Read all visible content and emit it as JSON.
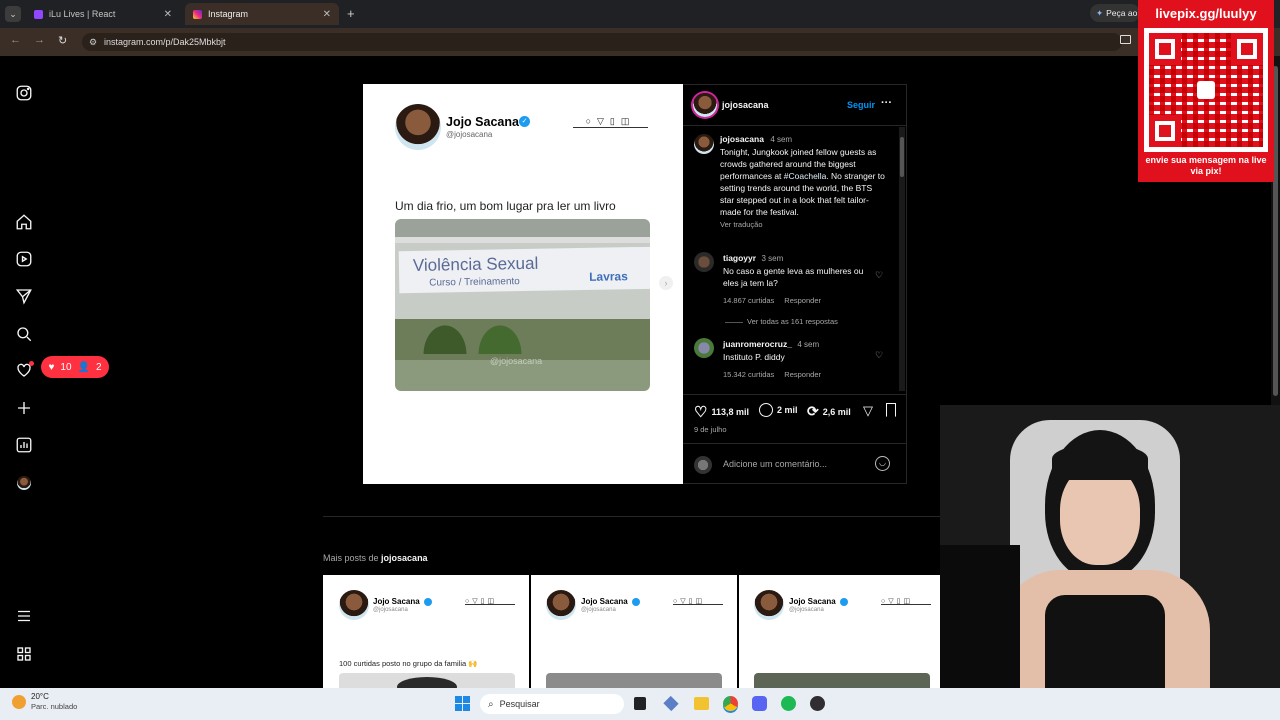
{
  "browser": {
    "tabs": [
      {
        "title": "iLu Lives | React"
      },
      {
        "title": "Instagram"
      }
    ],
    "url": "instagram.com/p/Dak25Mbkbjt",
    "ask_button": "Peça ao"
  },
  "sidebar": {
    "notif_likes": "10",
    "notif_follows": "2"
  },
  "post": {
    "image": {
      "author_name": "Jojo Sacana",
      "author_handle": "@jojosacana",
      "caption": "Um dia frio, um bom lugar pra ler um livro",
      "banner_text": "Violência Sexual",
      "banner_sub": "Curso / Treinamento",
      "banner_logo": "Lavras",
      "watermark": "@jojosacana"
    },
    "header": {
      "username": "jojosacana",
      "follow": "Seguir",
      "more": "···"
    },
    "caption": {
      "username": "jojosacana",
      "time": "4 sem",
      "text_before": "Tonight, Jungkook joined fellow guests as crowds gathered around the biggest performances at ",
      "hashtag": "#Coachella",
      "text_after": ". No stranger to setting trends around the world, the BTS star stepped out in a look that felt tailor-made for the festival.",
      "translate": "Ver tradução"
    },
    "comments": [
      {
        "username": "tiagoyyr",
        "time": "3 sem",
        "text": "No caso a gente leva as mulheres ou eles ja tem la?",
        "likes": "14.867 curtidas",
        "reply": "Responder",
        "view_replies": "Ver todas as 161 respostas"
      },
      {
        "username": "juanromerocruz_",
        "time": "4 sem",
        "text": "Instituto P. diddy",
        "likes": "15.342 curtidas",
        "reply": "Responder"
      }
    ],
    "actions": {
      "likes": "113,8 mil",
      "comments": "2 mil",
      "reposts": "2,6 mil"
    },
    "date": "9 de julho",
    "add_comment_placeholder": "Adicione um comentário..."
  },
  "more_posts": {
    "label": "Mais posts de",
    "username": "jojosacana",
    "cards": [
      {
        "name": "Jojo Sacana",
        "handle": "@jojosacana",
        "caption": "100 curtidas posto no grupo da familia 🙌"
      },
      {
        "name": "Jojo Sacana",
        "handle": "@jojosacana",
        "caption": ""
      },
      {
        "name": "Jojo Sacana",
        "handle": "@jojosacana",
        "caption": ""
      }
    ]
  },
  "overlay": {
    "livepix_url": "livepix.gg/luulyy",
    "livepix_msg": "envie sua mensagem na live via pix!"
  },
  "taskbar": {
    "temp": "20°C",
    "weather": "Parc. nublado",
    "search": "Pesquisar"
  },
  "colors": {
    "instagram_blue": "#0095f6",
    "notif_red": "#ff3040",
    "livepix_red": "#e0101c"
  }
}
